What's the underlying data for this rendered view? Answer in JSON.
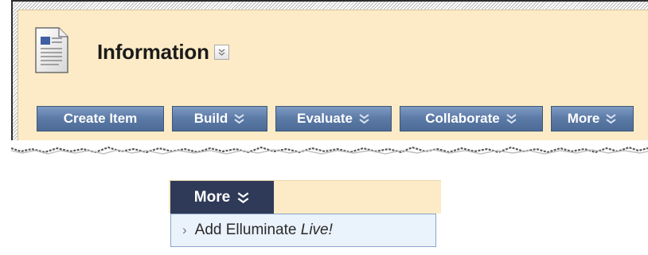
{
  "content_area": {
    "title": "Information",
    "title_menu_icon": "chevron-down-icon",
    "page_icon": "document-page-icon"
  },
  "action_bar": {
    "buttons": [
      {
        "label": "Create Item",
        "has_menu": false
      },
      {
        "label": "Build",
        "has_menu": true
      },
      {
        "label": "Evaluate",
        "has_menu": true
      },
      {
        "label": "Collaborate",
        "has_menu": true
      },
      {
        "label": "More",
        "has_menu": true
      }
    ],
    "menu_icon": "double-chevron-down-icon"
  },
  "dropdown": {
    "button_label": "More",
    "items": [
      {
        "label_prefix": "Add Elluminate ",
        "label_emphasis": "Live!"
      }
    ]
  },
  "colors": {
    "panel_background": "#fcebc6",
    "button_blue": "#5b7aa6",
    "dropdown_dark": "#2e3a57",
    "menu_highlight": "#eaf2fb"
  }
}
